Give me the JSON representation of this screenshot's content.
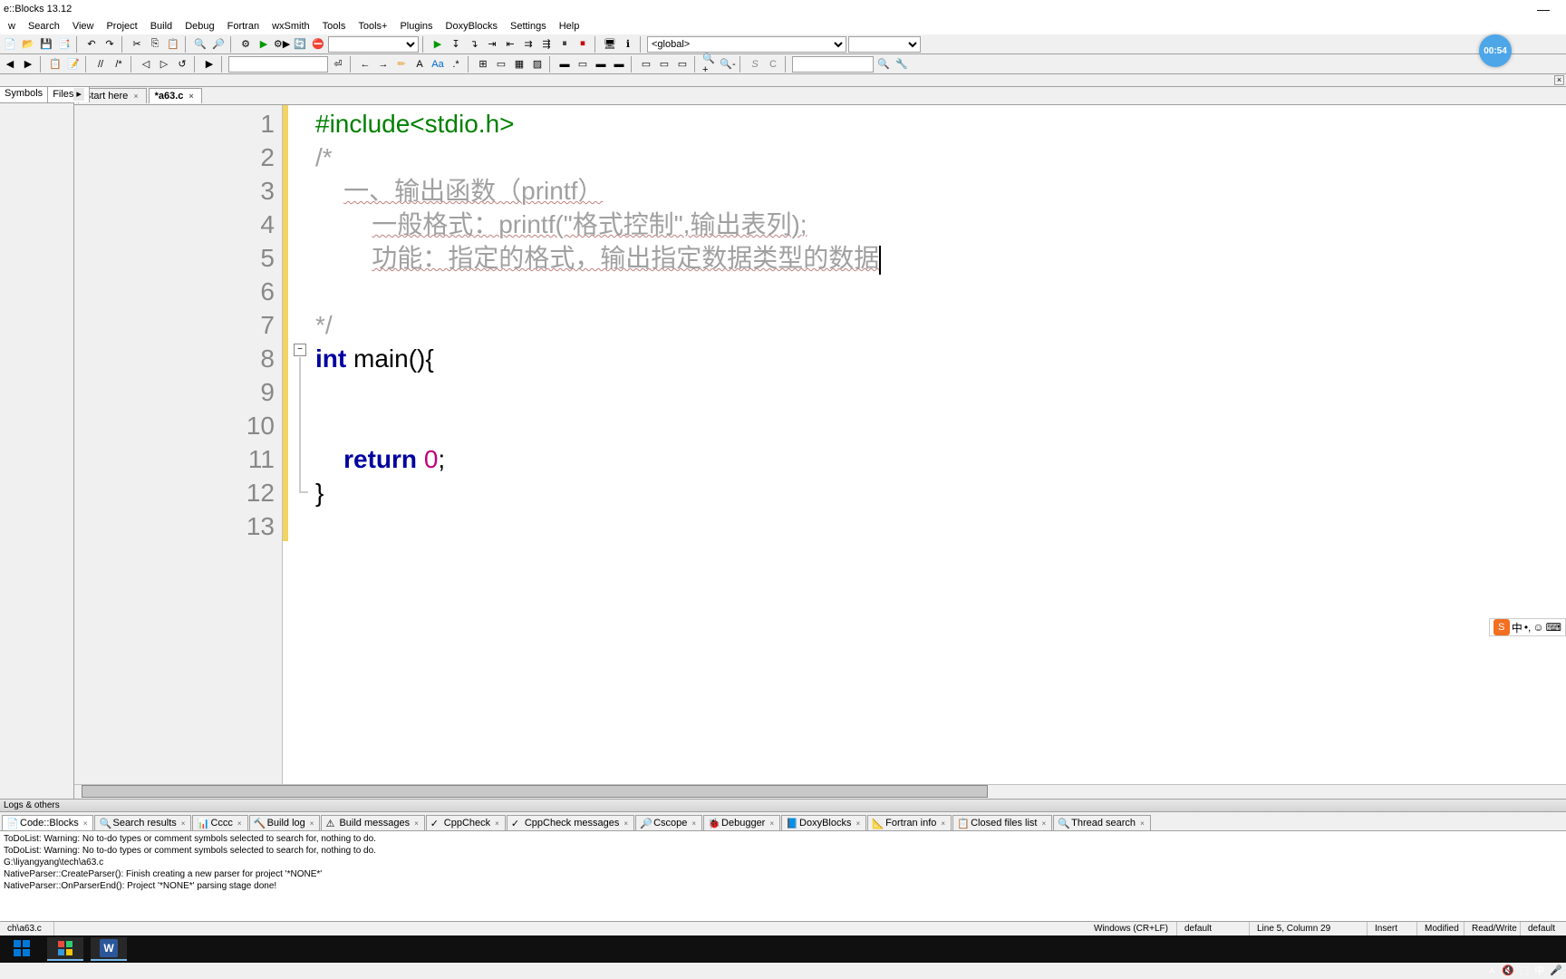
{
  "title": "e::Blocks 13.12",
  "menu": [
    "w",
    "Search",
    "View",
    "Project",
    "Build",
    "Debug",
    "Fortran",
    "wxSmith",
    "Tools",
    "Tools+",
    "Plugins",
    "DoxyBlocks",
    "Settings",
    "Help"
  ],
  "toolbar": {
    "scope_value": "<global>"
  },
  "left_panel": {
    "tabs": [
      "Symbols",
      "Files"
    ],
    "close": "×"
  },
  "editor": {
    "tabs": [
      {
        "label": "Start here",
        "active": false
      },
      {
        "label": "*a63.c",
        "active": true
      }
    ],
    "lines": [
      {
        "n": "1",
        "segments": [
          {
            "t": "#include<stdio.h>",
            "c": "pp"
          }
        ]
      },
      {
        "n": "2",
        "segments": [
          {
            "t": "/*",
            "c": "cm"
          }
        ]
      },
      {
        "n": "3",
        "segments": [
          {
            "t": "    ",
            "c": ""
          },
          {
            "t": "一、输出函数（printf）",
            "c": "cm-u"
          }
        ]
      },
      {
        "n": "4",
        "segments": [
          {
            "t": "        ",
            "c": ""
          },
          {
            "t": "一般格式：printf(\"格式控制\",输出表列);",
            "c": "cm-u"
          }
        ]
      },
      {
        "n": "5",
        "segments": [
          {
            "t": "        ",
            "c": ""
          },
          {
            "t": "功能：指定的格式，输出指定数据类型的数据",
            "c": "cm-u"
          }
        ],
        "caret": true
      },
      {
        "n": "6",
        "segments": []
      },
      {
        "n": "7",
        "segments": [
          {
            "t": "*/",
            "c": "cm"
          }
        ]
      },
      {
        "n": "8",
        "segments": [
          {
            "t": "int",
            "c": "kw"
          },
          {
            "t": " main(){",
            "c": ""
          }
        ]
      },
      {
        "n": "9",
        "segments": []
      },
      {
        "n": "10",
        "segments": []
      },
      {
        "n": "11",
        "segments": [
          {
            "t": "    ",
            "c": ""
          },
          {
            "t": "return",
            "c": "kw"
          },
          {
            "t": " ",
            "c": ""
          },
          {
            "t": "0",
            "c": "num"
          },
          {
            "t": ";",
            "c": ""
          }
        ]
      },
      {
        "n": "12",
        "segments": [
          {
            "t": "}",
            "c": ""
          }
        ]
      },
      {
        "n": "13",
        "segments": []
      }
    ]
  },
  "logs": {
    "header": "Logs & others",
    "tabs": [
      "Code::Blocks",
      "Search results",
      "Cccc",
      "Build log",
      "Build messages",
      "CppCheck",
      "CppCheck messages",
      "Cscope",
      "Debugger",
      "DoxyBlocks",
      "Fortran info",
      "Closed files list",
      "Thread search"
    ],
    "active_tab": 0,
    "lines": [
      "ToDoList: Warning: No to-do types or comment symbols selected to search for, nothing to do.",
      "ToDoList: Warning: No to-do types or comment symbols selected to search for, nothing to do.",
      "G:\\liyangyang\\tech\\a63.c",
      "NativeParser::CreateParser(): Finish creating a new parser for project '*NONE*'",
      "NativeParser::OnParserEnd(): Project '*NONE*' parsing stage done!"
    ]
  },
  "status": {
    "path": "ch\\a63.c",
    "encoding": "Windows (CR+LF)",
    "codepage": "default",
    "position": "Line 5, Column 29",
    "insert": "Insert",
    "modified": "Modified",
    "rw": "Read/Write",
    "profile": "default"
  },
  "timer": "00:54",
  "ime": {
    "logo": "S",
    "items": [
      "中",
      "•,",
      "☺",
      "⌨"
    ]
  },
  "tray": [
    "ㅅ",
    "🔇",
    "⬚",
    "中",
    "🎤"
  ]
}
